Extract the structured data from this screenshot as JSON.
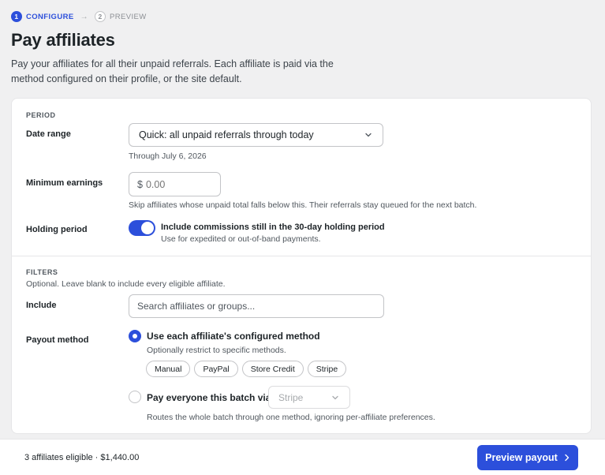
{
  "steps": [
    {
      "number": "1",
      "label": "CONFIGURE"
    },
    {
      "number": "2",
      "label": "PREVIEW"
    }
  ],
  "page": {
    "title": "Pay affiliates",
    "description": "Pay your affiliates for all their unpaid referrals. Each affiliate is paid via the method configured on their profile, or the site default."
  },
  "period": {
    "heading": "PERIOD",
    "date_range": {
      "label": "Date range",
      "value": "Quick: all unpaid referrals through today",
      "hint": "Through July 6, 2026"
    },
    "minimum_earnings": {
      "label": "Minimum earnings",
      "currency": "$",
      "placeholder": "0.00",
      "hint": "Skip affiliates whose unpaid total falls below this. Their referrals stay queued for the next batch."
    },
    "holding_period": {
      "label": "Holding period",
      "enabled": true,
      "title": "Include commissions still in the 30-day holding period",
      "subtitle": "Use for expedited or out-of-band payments."
    }
  },
  "filters": {
    "heading": "FILTERS",
    "description": "Optional. Leave blank to include every eligible affiliate.",
    "include": {
      "label": "Include",
      "placeholder": "Search affiliates or groups..."
    },
    "payout_method": {
      "label": "Payout method",
      "option_configured": {
        "title": "Use each affiliate's configured method",
        "subtitle": "Optionally restrict to specific methods.",
        "checked": true
      },
      "methods": [
        "Manual",
        "PayPal",
        "Store Credit",
        "Stripe"
      ],
      "option_batch": {
        "title": "Pay everyone this batch via",
        "selected": "Stripe",
        "hint": "Routes the whole batch through one method, ignoring per-affiliate preferences.",
        "checked": false
      }
    }
  },
  "footer": {
    "summary": "3 affiliates eligible · $1,440.00",
    "primary_button": "Preview payout"
  },
  "colors": {
    "accent": "#2c4fdb",
    "background": "#f0f0f1"
  }
}
